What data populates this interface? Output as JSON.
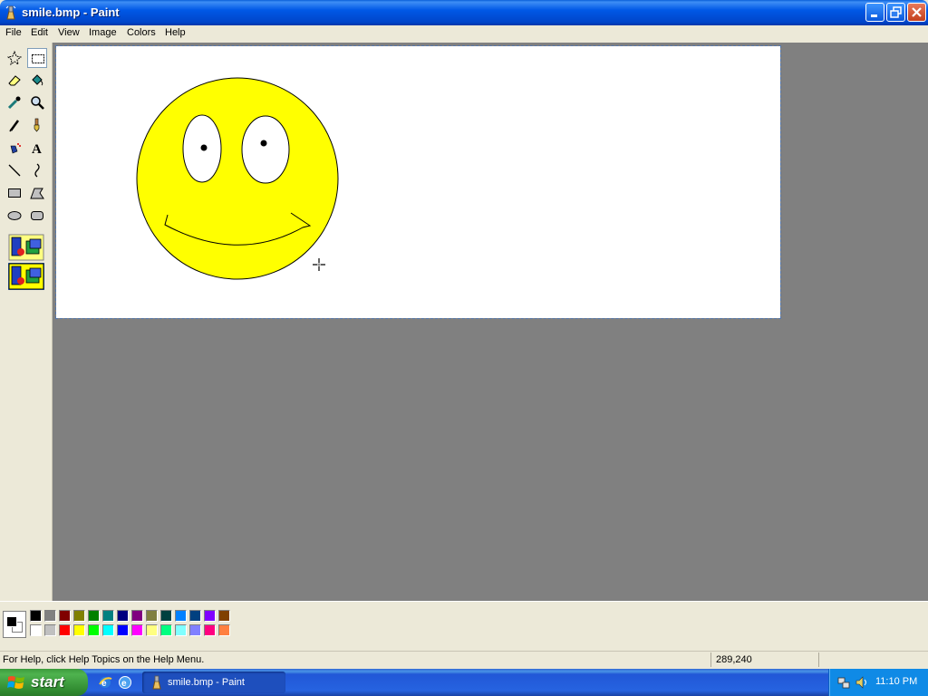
{
  "window": {
    "title": "smile.bmp - Paint"
  },
  "menu": {
    "items": [
      "File",
      "Edit",
      "View",
      "Image",
      "Colors",
      "Help"
    ]
  },
  "toolbox": {
    "tools": [
      {
        "name": "free-form-select",
        "icon": "free-form-select-icon"
      },
      {
        "name": "select",
        "icon": "rectangle-select-icon",
        "selected": true
      },
      {
        "name": "eraser",
        "icon": "eraser-icon"
      },
      {
        "name": "fill-with-color",
        "icon": "paint-bucket-icon"
      },
      {
        "name": "pick-color",
        "icon": "eyedropper-icon"
      },
      {
        "name": "magnifier",
        "icon": "magnifier-icon"
      },
      {
        "name": "pencil",
        "icon": "pencil-icon"
      },
      {
        "name": "brush",
        "icon": "brush-icon"
      },
      {
        "name": "airbrush",
        "icon": "airbrush-icon"
      },
      {
        "name": "text",
        "icon": "text-icon",
        "glyph": "A"
      },
      {
        "name": "line",
        "icon": "line-icon"
      },
      {
        "name": "curve",
        "icon": "curve-icon"
      },
      {
        "name": "rectangle",
        "icon": "rectangle-icon"
      },
      {
        "name": "polygon",
        "icon": "polygon-icon"
      },
      {
        "name": "ellipse",
        "icon": "ellipse-icon"
      },
      {
        "name": "rounded-rectangle",
        "icon": "rounded-rectangle-icon"
      }
    ],
    "options": [
      "opaque-background-icon",
      "transparent-background-icon"
    ]
  },
  "canvas": {
    "background": "#ffffff",
    "face_color": "#ffff00",
    "outline_color": "#000000"
  },
  "palette": {
    "foreground": "#000000",
    "background": "#ffffff",
    "row1": [
      "#000000",
      "#808080",
      "#800000",
      "#808000",
      "#008000",
      "#008080",
      "#000080",
      "#800080",
      "#808040",
      "#004040",
      "#0080ff",
      "#004080",
      "#8000ff",
      "#804000"
    ],
    "row2": [
      "#ffffff",
      "#c0c0c0",
      "#ff0000",
      "#ffff00",
      "#00ff00",
      "#00ffff",
      "#0000ff",
      "#ff00ff",
      "#ffff80",
      "#00ff80",
      "#80ffff",
      "#8080ff",
      "#ff0080",
      "#ff8040"
    ]
  },
  "status": {
    "help": "For Help, click Help Topics on the Help Menu.",
    "coords": "289,240"
  },
  "taskbar": {
    "start_label": "start",
    "task_label": "smile.bmp - Paint",
    "clock": "11:10 PM",
    "accent": "#245edb",
    "start_green": "#3c9b3c"
  }
}
